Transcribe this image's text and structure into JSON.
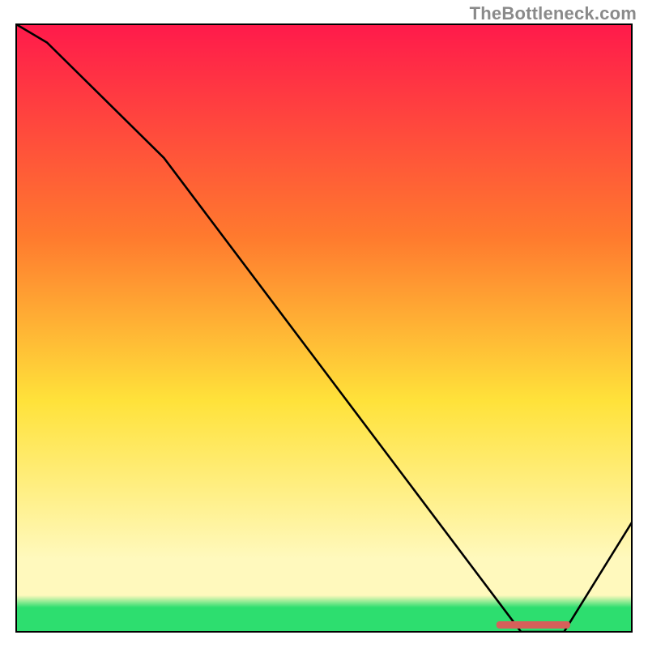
{
  "watermark": "TheBottleneck.com",
  "colors": {
    "top": "#ff1a4b",
    "mid1": "#ff7a2e",
    "mid2": "#ffe23a",
    "pale": "#fff9bd",
    "green": "#2dde6f",
    "line": "#000000",
    "marker": "#d6605a",
    "frame": "#000000"
  },
  "chart_data": {
    "type": "line",
    "title": "",
    "xlabel": "",
    "ylabel": "",
    "xlim": [
      0,
      100
    ],
    "ylim": [
      0,
      100
    ],
    "x": [
      0,
      5,
      24,
      82,
      89,
      100
    ],
    "values": [
      100,
      97,
      78,
      0,
      0,
      18
    ],
    "marker_band": {
      "x0": 78,
      "x1": 90,
      "y": 1.2
    },
    "gradient_stops_pct": [
      0,
      35,
      62,
      88,
      94,
      96,
      100
    ]
  }
}
